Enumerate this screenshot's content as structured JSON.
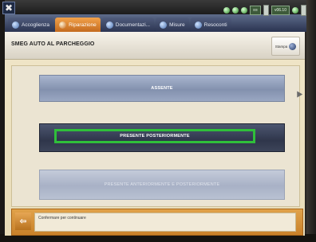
{
  "corner": {
    "icon": "pliers-icon",
    "glyph": "✖"
  },
  "nav": {
    "tabs": [
      {
        "label": "Accoglienza",
        "active": false
      },
      {
        "label": "Riparazione",
        "active": true
      },
      {
        "label": "Documentazi...",
        "active": false
      },
      {
        "label": "Misure",
        "active": false
      },
      {
        "label": "Resoconti",
        "active": false
      }
    ],
    "status_chip": "≡≡",
    "version": "v06.10"
  },
  "window": {
    "title": "SMEG AUTO AL PARCHEGGIO",
    "print_label": "Stampa"
  },
  "options": {
    "absent": "ASSENTE",
    "rear_present": "PRESENTE POSTERIORMENTE",
    "front_rear_present": "PRESENTE ANTERIORMENTE E POSTERIORMENTE"
  },
  "footer": {
    "back_glyph": "⇦",
    "message": "Confermare per continuare"
  },
  "colors": {
    "active_tab": "#e08a30",
    "selection_frame": "#2fbf3a",
    "selected_option": "#2f364b"
  }
}
